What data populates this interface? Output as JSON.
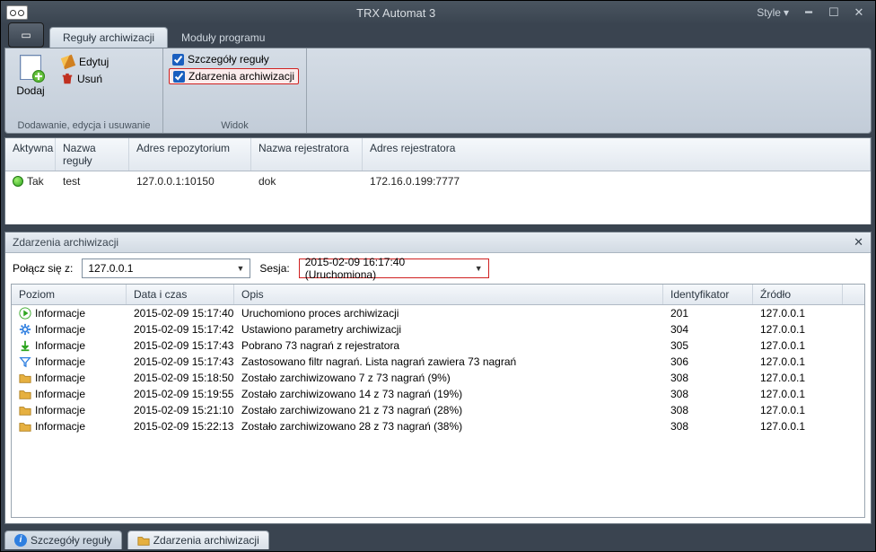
{
  "window": {
    "title": "TRX Automat 3",
    "style_label": "Style"
  },
  "tabs": {
    "reguly": "Reguły archiwizacji",
    "moduly": "Moduły programu"
  },
  "ribbon": {
    "group_add": "Dodawanie, edycja i usuwanie",
    "group_widok": "Widok",
    "dodaj": "Dodaj",
    "edytuj": "Edytuj",
    "usun": "Usuń",
    "szczegoly_reguly": "Szczegóły reguły",
    "zdarzenia_arch": "Zdarzenia archiwizacji"
  },
  "rules": {
    "headers": {
      "aktywna": "Aktywna",
      "nazwa": "Nazwa reguły",
      "repo": "Adres repozytorium",
      "rej": "Nazwa rejestratora",
      "adr": "Adres rejestratora"
    },
    "row": {
      "aktywna": "Tak",
      "nazwa": "test",
      "repo": "127.0.0.1:10150",
      "rej": "dok",
      "adr": "172.16.0.199:7777"
    }
  },
  "events_panel": {
    "title": "Zdarzenia archiwizacji",
    "polacz_label": "Połącz się z:",
    "polacz_value": "127.0.0.1",
    "sesja_label": "Sesja:",
    "sesja_value": "2015-02-09 16:17:40 (Uruchomiona)"
  },
  "events": {
    "headers": {
      "poziom": "Poziom",
      "czas": "Data i czas",
      "opis": "Opis",
      "ident": "Identyfikator",
      "zrodlo": "Źródło"
    },
    "rows": [
      {
        "icon": "play",
        "poziom": "Informacje",
        "czas": "2015-02-09 15:17:40",
        "opis": "Uruchomiono proces archiwizacji",
        "ident": "201",
        "zrodlo": "127.0.0.1"
      },
      {
        "icon": "gear",
        "poziom": "Informacje",
        "czas": "2015-02-09 15:17:42",
        "opis": "Ustawiono parametry archiwizacji",
        "ident": "304",
        "zrodlo": "127.0.0.1"
      },
      {
        "icon": "down",
        "poziom": "Informacje",
        "czas": "2015-02-09 15:17:43",
        "opis": "Pobrano 73 nagrań z rejestratora",
        "ident": "305",
        "zrodlo": "127.0.0.1"
      },
      {
        "icon": "filter",
        "poziom": "Informacje",
        "czas": "2015-02-09 15:17:43",
        "opis": "Zastosowano filtr nagrań. Lista nagrań zawiera 73 nagrań",
        "ident": "306",
        "zrodlo": "127.0.0.1"
      },
      {
        "icon": "folder",
        "poziom": "Informacje",
        "czas": "2015-02-09 15:18:50",
        "opis": "Zostało zarchiwizowano 7 z 73 nagrań (9%)",
        "ident": "308",
        "zrodlo": "127.0.0.1"
      },
      {
        "icon": "folder",
        "poziom": "Informacje",
        "czas": "2015-02-09 15:19:55",
        "opis": "Zostało zarchiwizowano 14 z 73 nagrań (19%)",
        "ident": "308",
        "zrodlo": "127.0.0.1"
      },
      {
        "icon": "folder",
        "poziom": "Informacje",
        "czas": "2015-02-09 15:21:10",
        "opis": "Zostało zarchiwizowano 21 z 73 nagrań (28%)",
        "ident": "308",
        "zrodlo": "127.0.0.1"
      },
      {
        "icon": "folder",
        "poziom": "Informacje",
        "czas": "2015-02-09 15:22:13",
        "opis": "Zostało zarchiwizowano 28 z 73 nagrań (38%)",
        "ident": "308",
        "zrodlo": "127.0.0.1"
      }
    ]
  },
  "status": {
    "szczegoly": "Szczegóły reguły",
    "zdarzenia": "Zdarzenia archiwizacji"
  }
}
